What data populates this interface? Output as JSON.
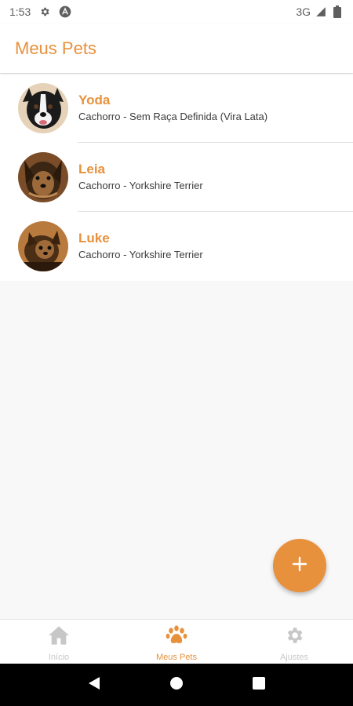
{
  "status_bar": {
    "time": "1:53",
    "network": "3G",
    "icons": [
      "gear-icon",
      "a-badge-icon",
      "signal-icon",
      "battery-icon"
    ]
  },
  "app_bar": {
    "title": "Meus Pets"
  },
  "pets": [
    {
      "name": "Yoda",
      "description": "Cachorro - Sem Raça Definida (Vira Lata)"
    },
    {
      "name": "Leia",
      "description": "Cachorro - Yorkshire Terrier"
    },
    {
      "name": "Luke",
      "description": "Cachorro - Yorkshire Terrier"
    }
  ],
  "fab": {
    "icon": "plus-icon"
  },
  "bottom_nav": {
    "items": [
      {
        "label": "Início",
        "icon": "home-icon",
        "active": false
      },
      {
        "label": "Meus Pets",
        "icon": "paw-icon",
        "active": true
      },
      {
        "label": "Ajustes",
        "icon": "gear-icon",
        "active": false
      }
    ]
  },
  "colors": {
    "accent": "#e8913c",
    "inactive": "#c7c7c7",
    "background": "#f8f8f8"
  }
}
